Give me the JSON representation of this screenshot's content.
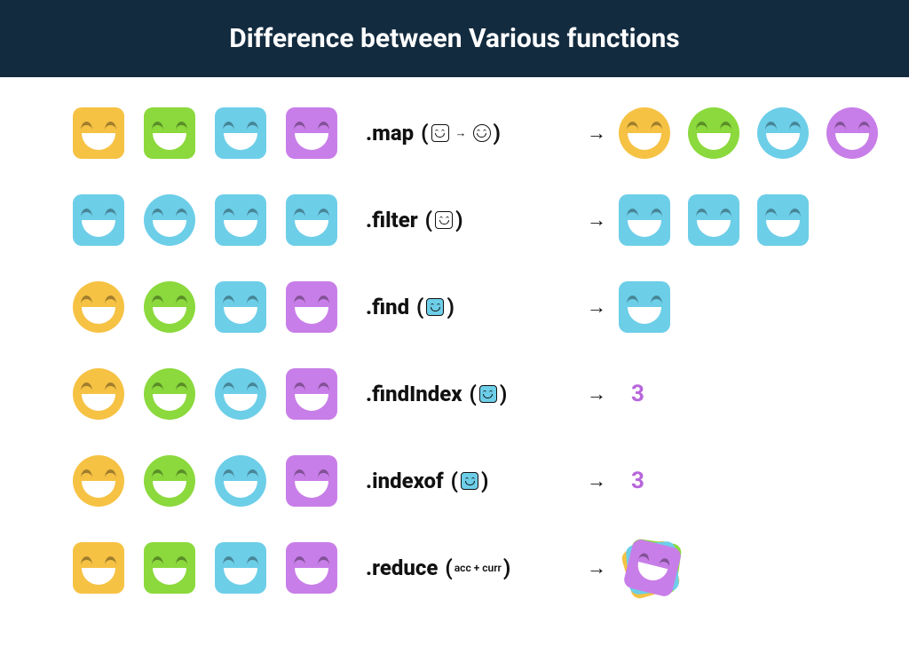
{
  "title": "Difference between Various functions",
  "colors": {
    "yellow": "#f6c244",
    "green": "#8bd93c",
    "blue": "#6dcee8",
    "purple": "#c87ee8",
    "purpleText": "#b766db",
    "headerBg": "#132b3f"
  },
  "rows": [
    {
      "id": "map",
      "input": [
        {
          "shape": "square",
          "color": "yellow"
        },
        {
          "shape": "square",
          "color": "green"
        },
        {
          "shape": "square",
          "color": "blue"
        },
        {
          "shape": "square",
          "color": "purple"
        }
      ],
      "fn": ".map",
      "argType": "transform",
      "output": {
        "type": "faces",
        "items": [
          {
            "shape": "circle",
            "color": "yellow"
          },
          {
            "shape": "circle",
            "color": "green"
          },
          {
            "shape": "circle",
            "color": "blue"
          },
          {
            "shape": "circle",
            "color": "purple"
          }
        ]
      }
    },
    {
      "id": "filter",
      "input": [
        {
          "shape": "square",
          "color": "blue"
        },
        {
          "shape": "circle",
          "color": "blue"
        },
        {
          "shape": "square",
          "color": "blue"
        },
        {
          "shape": "square",
          "color": "blue"
        }
      ],
      "fn": ".filter",
      "argType": "outline",
      "output": {
        "type": "faces",
        "items": [
          {
            "shape": "square",
            "color": "blue"
          },
          {
            "shape": "square",
            "color": "blue"
          },
          {
            "shape": "square",
            "color": "blue"
          }
        ]
      }
    },
    {
      "id": "find",
      "input": [
        {
          "shape": "circle",
          "color": "yellow"
        },
        {
          "shape": "circle",
          "color": "green"
        },
        {
          "shape": "square",
          "color": "blue"
        },
        {
          "shape": "square",
          "color": "purple"
        }
      ],
      "fn": ".find",
      "argType": "filled",
      "output": {
        "type": "faces",
        "items": [
          {
            "shape": "square",
            "color": "blue"
          }
        ]
      }
    },
    {
      "id": "findIndex",
      "input": [
        {
          "shape": "circle",
          "color": "yellow"
        },
        {
          "shape": "circle",
          "color": "green"
        },
        {
          "shape": "circle",
          "color": "blue"
        },
        {
          "shape": "square",
          "color": "purple"
        }
      ],
      "fn": ".findIndex",
      "argType": "filled",
      "output": {
        "type": "number",
        "value": "3",
        "color": "purpleText"
      }
    },
    {
      "id": "indexof",
      "input": [
        {
          "shape": "circle",
          "color": "yellow"
        },
        {
          "shape": "circle",
          "color": "green"
        },
        {
          "shape": "circle",
          "color": "blue"
        },
        {
          "shape": "square",
          "color": "purple"
        }
      ],
      "fn": ".indexof",
      "argType": "filled",
      "output": {
        "type": "number",
        "value": "3",
        "color": "purpleText"
      }
    },
    {
      "id": "reduce",
      "input": [
        {
          "shape": "square",
          "color": "yellow"
        },
        {
          "shape": "square",
          "color": "green"
        },
        {
          "shape": "square",
          "color": "blue"
        },
        {
          "shape": "square",
          "color": "purple"
        }
      ],
      "fn": ".reduce",
      "argType": "text",
      "argText": "acc + curr",
      "output": {
        "type": "stack"
      }
    }
  ],
  "arrow": "→"
}
